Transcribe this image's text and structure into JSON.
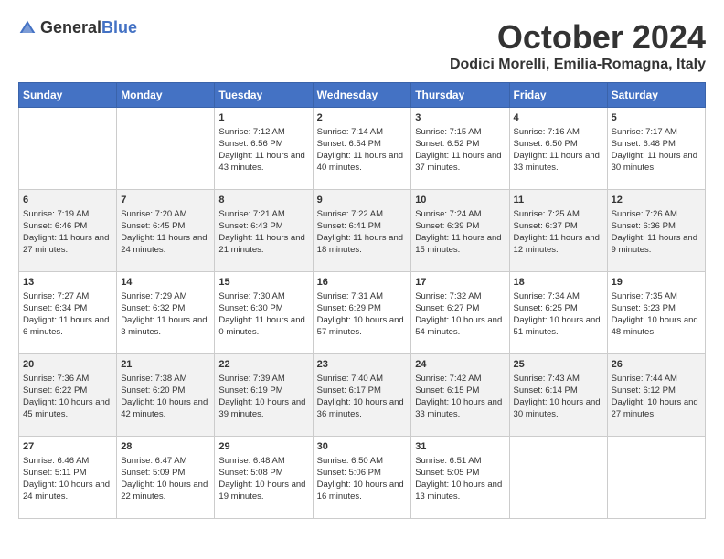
{
  "header": {
    "logo_general": "General",
    "logo_blue": "Blue",
    "month": "October 2024",
    "location": "Dodici Morelli, Emilia-Romagna, Italy"
  },
  "days_of_week": [
    "Sunday",
    "Monday",
    "Tuesday",
    "Wednesday",
    "Thursday",
    "Friday",
    "Saturday"
  ],
  "weeks": [
    [
      {
        "day": "",
        "content": ""
      },
      {
        "day": "",
        "content": ""
      },
      {
        "day": "1",
        "content": "Sunrise: 7:12 AM\nSunset: 6:56 PM\nDaylight: 11 hours and 43 minutes."
      },
      {
        "day": "2",
        "content": "Sunrise: 7:14 AM\nSunset: 6:54 PM\nDaylight: 11 hours and 40 minutes."
      },
      {
        "day": "3",
        "content": "Sunrise: 7:15 AM\nSunset: 6:52 PM\nDaylight: 11 hours and 37 minutes."
      },
      {
        "day": "4",
        "content": "Sunrise: 7:16 AM\nSunset: 6:50 PM\nDaylight: 11 hours and 33 minutes."
      },
      {
        "day": "5",
        "content": "Sunrise: 7:17 AM\nSunset: 6:48 PM\nDaylight: 11 hours and 30 minutes."
      }
    ],
    [
      {
        "day": "6",
        "content": "Sunrise: 7:19 AM\nSunset: 6:46 PM\nDaylight: 11 hours and 27 minutes."
      },
      {
        "day": "7",
        "content": "Sunrise: 7:20 AM\nSunset: 6:45 PM\nDaylight: 11 hours and 24 minutes."
      },
      {
        "day": "8",
        "content": "Sunrise: 7:21 AM\nSunset: 6:43 PM\nDaylight: 11 hours and 21 minutes."
      },
      {
        "day": "9",
        "content": "Sunrise: 7:22 AM\nSunset: 6:41 PM\nDaylight: 11 hours and 18 minutes."
      },
      {
        "day": "10",
        "content": "Sunrise: 7:24 AM\nSunset: 6:39 PM\nDaylight: 11 hours and 15 minutes."
      },
      {
        "day": "11",
        "content": "Sunrise: 7:25 AM\nSunset: 6:37 PM\nDaylight: 11 hours and 12 minutes."
      },
      {
        "day": "12",
        "content": "Sunrise: 7:26 AM\nSunset: 6:36 PM\nDaylight: 11 hours and 9 minutes."
      }
    ],
    [
      {
        "day": "13",
        "content": "Sunrise: 7:27 AM\nSunset: 6:34 PM\nDaylight: 11 hours and 6 minutes."
      },
      {
        "day": "14",
        "content": "Sunrise: 7:29 AM\nSunset: 6:32 PM\nDaylight: 11 hours and 3 minutes."
      },
      {
        "day": "15",
        "content": "Sunrise: 7:30 AM\nSunset: 6:30 PM\nDaylight: 11 hours and 0 minutes."
      },
      {
        "day": "16",
        "content": "Sunrise: 7:31 AM\nSunset: 6:29 PM\nDaylight: 10 hours and 57 minutes."
      },
      {
        "day": "17",
        "content": "Sunrise: 7:32 AM\nSunset: 6:27 PM\nDaylight: 10 hours and 54 minutes."
      },
      {
        "day": "18",
        "content": "Sunrise: 7:34 AM\nSunset: 6:25 PM\nDaylight: 10 hours and 51 minutes."
      },
      {
        "day": "19",
        "content": "Sunrise: 7:35 AM\nSunset: 6:23 PM\nDaylight: 10 hours and 48 minutes."
      }
    ],
    [
      {
        "day": "20",
        "content": "Sunrise: 7:36 AM\nSunset: 6:22 PM\nDaylight: 10 hours and 45 minutes."
      },
      {
        "day": "21",
        "content": "Sunrise: 7:38 AM\nSunset: 6:20 PM\nDaylight: 10 hours and 42 minutes."
      },
      {
        "day": "22",
        "content": "Sunrise: 7:39 AM\nSunset: 6:19 PM\nDaylight: 10 hours and 39 minutes."
      },
      {
        "day": "23",
        "content": "Sunrise: 7:40 AM\nSunset: 6:17 PM\nDaylight: 10 hours and 36 minutes."
      },
      {
        "day": "24",
        "content": "Sunrise: 7:42 AM\nSunset: 6:15 PM\nDaylight: 10 hours and 33 minutes."
      },
      {
        "day": "25",
        "content": "Sunrise: 7:43 AM\nSunset: 6:14 PM\nDaylight: 10 hours and 30 minutes."
      },
      {
        "day": "26",
        "content": "Sunrise: 7:44 AM\nSunset: 6:12 PM\nDaylight: 10 hours and 27 minutes."
      }
    ],
    [
      {
        "day": "27",
        "content": "Sunrise: 6:46 AM\nSunset: 5:11 PM\nDaylight: 10 hours and 24 minutes."
      },
      {
        "day": "28",
        "content": "Sunrise: 6:47 AM\nSunset: 5:09 PM\nDaylight: 10 hours and 22 minutes."
      },
      {
        "day": "29",
        "content": "Sunrise: 6:48 AM\nSunset: 5:08 PM\nDaylight: 10 hours and 19 minutes."
      },
      {
        "day": "30",
        "content": "Sunrise: 6:50 AM\nSunset: 5:06 PM\nDaylight: 10 hours and 16 minutes."
      },
      {
        "day": "31",
        "content": "Sunrise: 6:51 AM\nSunset: 5:05 PM\nDaylight: 10 hours and 13 minutes."
      },
      {
        "day": "",
        "content": ""
      },
      {
        "day": "",
        "content": ""
      }
    ]
  ]
}
